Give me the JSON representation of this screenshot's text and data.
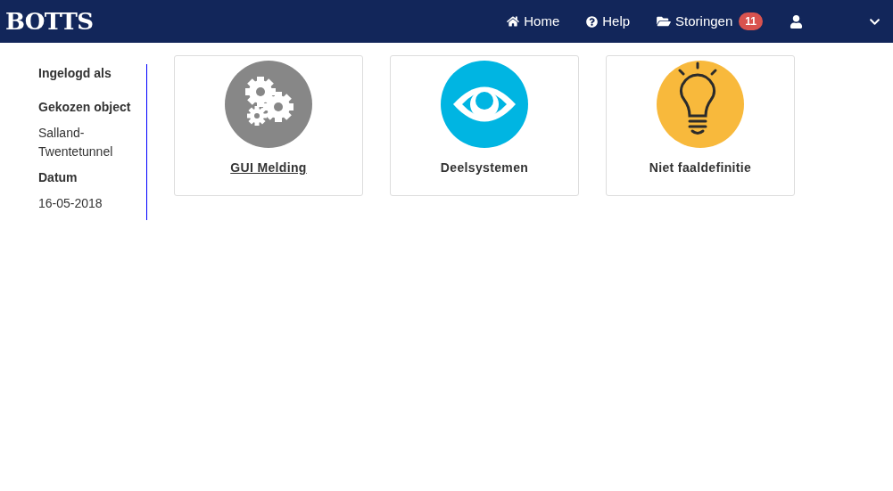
{
  "navbar": {
    "brand": "BOTTS",
    "links": [
      {
        "kind": "home",
        "label": "Home"
      },
      {
        "kind": "help",
        "label": "Help"
      },
      {
        "kind": "folder",
        "label": "Storingen",
        "badge": "11"
      }
    ]
  },
  "sidebar": [
    {
      "kind": "heading",
      "text": "Ingelogd als"
    },
    {
      "kind": "spacer"
    },
    {
      "kind": "heading",
      "text": "Gekozen object"
    },
    {
      "kind": "value",
      "text": "Salland-\nTwentetunnel"
    },
    {
      "kind": "heading",
      "text": "Datum"
    },
    {
      "kind": "value",
      "text": "16-05-2018"
    }
  ],
  "cards": [
    {
      "kind": "gears",
      "label": "GUI Melding",
      "color": "#878787",
      "hovered": true
    },
    {
      "kind": "eye",
      "label": "Deelsystemen",
      "color": "#00b5e2",
      "hovered": false
    },
    {
      "kind": "bulb",
      "label": "Niet faaldefinitie",
      "color": "#f8b93c",
      "hovered": false
    }
  ]
}
